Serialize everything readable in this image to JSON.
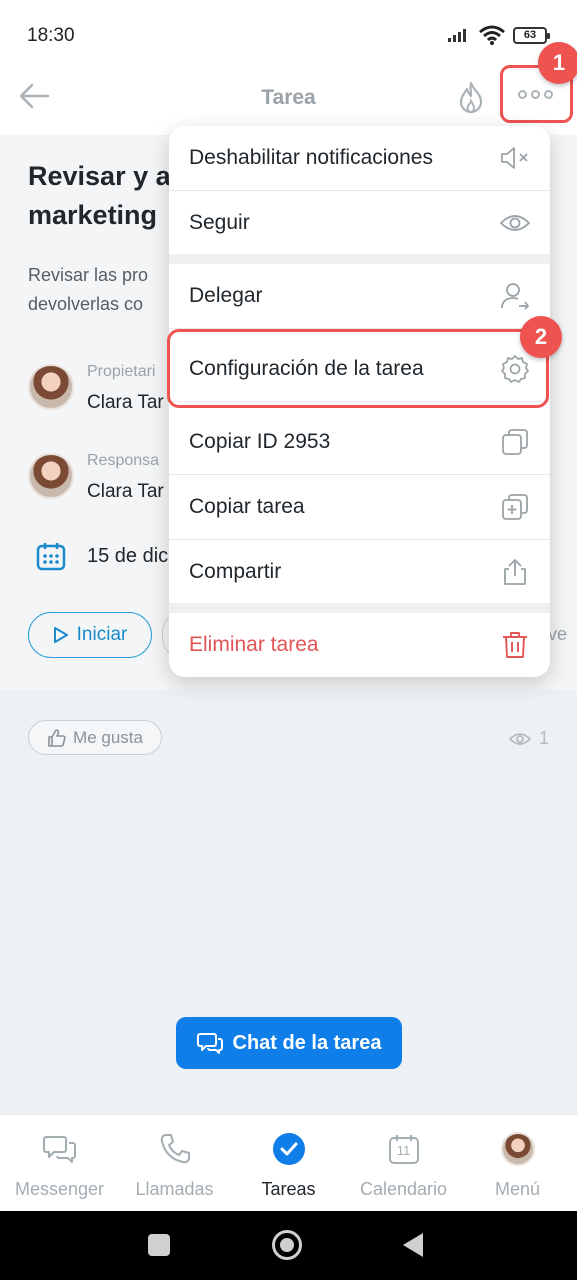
{
  "status_bar": {
    "time": "18:30",
    "battery": "63"
  },
  "header": {
    "title": "Tarea"
  },
  "annotations": {
    "badge_1": "1",
    "badge_2": "2"
  },
  "task": {
    "title": "Revisar y a marketing",
    "description": "Revisar las pro devolverlas co",
    "owner_label": "Propietari",
    "owner_name": "Clara Tar",
    "responsible_label": "Responsa",
    "responsible_name": "Clara Tar",
    "date": "15 de dic",
    "start_label": "Iniciar",
    "side_text": "ve"
  },
  "menu": {
    "items": [
      {
        "label": "Deshabilitar notificaciones",
        "icon": "mute-icon"
      },
      {
        "label": "Seguir",
        "icon": "eye-icon"
      },
      {
        "label": "Delegar",
        "icon": "delegate-user-icon"
      },
      {
        "label": "Configuración de la tarea",
        "icon": "gear-icon"
      },
      {
        "label": "Copiar ID 2953",
        "icon": "copy-icon"
      },
      {
        "label": "Copiar tarea",
        "icon": "copy-plus-icon"
      },
      {
        "label": "Compartir",
        "icon": "share-icon"
      },
      {
        "label": "Eliminar tarea",
        "icon": "trash-icon"
      }
    ]
  },
  "feed": {
    "like_label": "Me gusta",
    "views": "1"
  },
  "chat_button": "Chat de la tarea",
  "tabs": [
    {
      "label": "Messenger",
      "icon": "chat-bubbles-icon"
    },
    {
      "label": "Llamadas",
      "icon": "phone-icon"
    },
    {
      "label": "Tareas",
      "icon": "check-circle-icon"
    },
    {
      "label": "Calendario",
      "icon": "calendar-icon",
      "icon_text": "11"
    },
    {
      "label": "Menú",
      "icon": "avatar-icon"
    }
  ],
  "colors": {
    "accent": "#0f7ee8",
    "highlight": "#ef5350",
    "danger": "#e05555"
  }
}
